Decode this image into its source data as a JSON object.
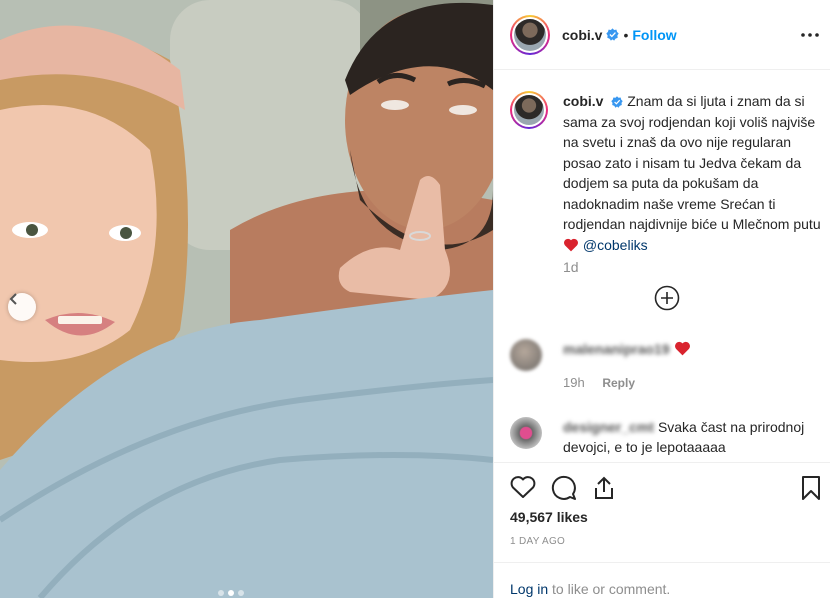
{
  "post": {
    "username": "cobi.v",
    "follow_label": "Follow",
    "separator": "•",
    "more_icon": "more-horizontal-icon",
    "caption": {
      "username": "cobi.v",
      "text": "Znam da si ljuta i znam da si sama za svoj rodjendan koji voliš najviše na svetu i znaš da ovo nije regularan posao zato i nisam tu Jedva čekam da dodjem sa puta da pokušam da nadoknadim naše vreme Srećan ti rodjendan najdivnije biće u Mlečnom putu",
      "mention": "@cobeliks",
      "age": "1d"
    },
    "comments": [
      {
        "username": "malenaniprao19",
        "text": "",
        "age": "19h",
        "reply_label": "Reply"
      },
      {
        "username": "designer_cmt",
        "text": "Svaka čast na prirodnoj devojci, e to je lepotaaaaa"
      }
    ],
    "likes": "49,567 likes",
    "posted_ago": "1 DAY AGO",
    "footer": {
      "login_link": "Log in",
      "login_suffix": "to like or comment."
    }
  },
  "colors": {
    "link_blue": "#0095f6",
    "heart_red": "#ed4956",
    "muted": "#8e8e8e",
    "text": "#262626"
  },
  "photo": {
    "description_icon": "post-photo",
    "carousel_dots": 3,
    "active_dot": 1
  }
}
